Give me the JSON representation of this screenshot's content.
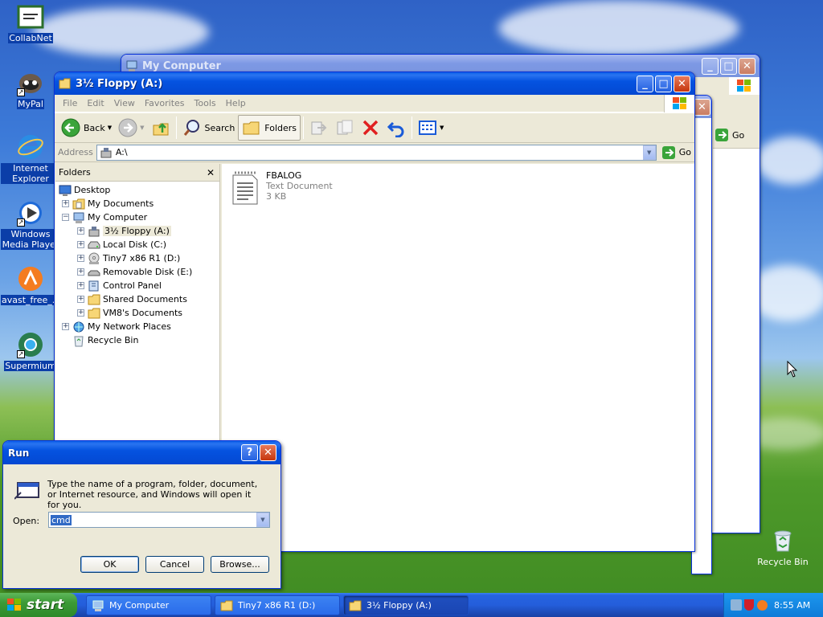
{
  "desktop": {
    "icons": [
      {
        "label": "CollabNet",
        "icon": "collabnet-icon"
      },
      {
        "label": "MyPal",
        "icon": "mypal-icon"
      },
      {
        "label": "Internet Explorer",
        "icon": "internet-explorer-icon"
      },
      {
        "label": "Windows Media Player",
        "icon": "windows-media-player-icon"
      },
      {
        "label": "avast_free_...",
        "icon": "avast-icon"
      },
      {
        "label": "Supermium",
        "icon": "supermium-icon"
      },
      {
        "label": "Recycle Bin",
        "icon": "recycle-bin-icon"
      }
    ]
  },
  "back_window": {
    "title": "My Computer",
    "go_label": "Go"
  },
  "floppy_window": {
    "title": "3½ Floppy (A:)",
    "menu": [
      "File",
      "Edit",
      "View",
      "Favorites",
      "Tools",
      "Help"
    ],
    "toolbar": {
      "back": "Back",
      "search": "Search",
      "folders": "Folders"
    },
    "address": {
      "label": "Address",
      "value": "A:\\",
      "go": "Go"
    },
    "folders_pane": {
      "title": "Folders",
      "tree": [
        {
          "label": "Desktop",
          "icon": "desktop-icon",
          "level": 0
        },
        {
          "label": "My Documents",
          "icon": "my-documents-icon",
          "level": 1
        },
        {
          "label": "My Computer",
          "icon": "my-computer-icon",
          "level": 1
        },
        {
          "label": "3½ Floppy (A:)",
          "icon": "floppy-drive-icon",
          "level": 2
        },
        {
          "label": "Local Disk (C:)",
          "icon": "hard-disk-icon",
          "level": 2
        },
        {
          "label": "Tiny7 x86 R1 (D:)",
          "icon": "cd-drive-icon",
          "level": 2
        },
        {
          "label": "Removable Disk (E:)",
          "icon": "removable-disk-icon",
          "level": 2
        },
        {
          "label": "Control Panel",
          "icon": "control-panel-icon",
          "level": 2
        },
        {
          "label": "Shared Documents",
          "icon": "folder-icon",
          "level": 2
        },
        {
          "label": "VM8's Documents",
          "icon": "folder-icon",
          "level": 2
        },
        {
          "label": "My Network Places",
          "icon": "network-places-icon",
          "level": 1
        },
        {
          "label": "Recycle Bin",
          "icon": "recycle-bin-icon",
          "level": 1
        }
      ]
    },
    "files": [
      {
        "name": "FBALOG",
        "type": "Text Document",
        "size": "3 KB",
        "icon": "text-document-icon"
      }
    ]
  },
  "run_dialog": {
    "title": "Run",
    "description": "Type the name of a program, folder, document, or Internet resource, and Windows will open it for you.",
    "open_label": "Open:",
    "open_value": "cmd",
    "ok": "OK",
    "cancel": "Cancel",
    "browse": "Browse..."
  },
  "taskbar": {
    "start": "start",
    "tasks": [
      {
        "label": "My Computer"
      },
      {
        "label": "Tiny7 x86 R1 (D:)"
      },
      {
        "label": "3½ Floppy (A:)"
      }
    ],
    "clock": "8:55 AM"
  },
  "colors": {
    "title_active": "#0553e0",
    "desktop_sky": "#3c7ad8",
    "desktop_grass": "#4e9a2a",
    "taskbar": "#245edb",
    "start_green": "#3c9a37"
  }
}
